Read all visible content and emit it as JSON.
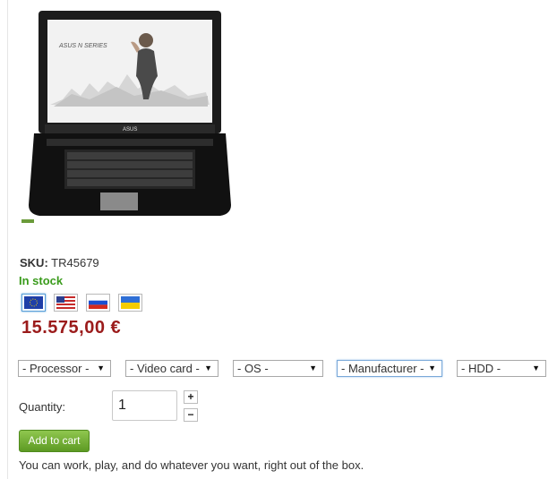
{
  "product": {
    "image_logo_text": "ASUS",
    "image_series_text": "ASUS N SERIES",
    "sku_label": "SKU:",
    "sku_value": "TR45679",
    "stock": "In stock",
    "price": "15.575,00 €",
    "description": "You can work, play, and do whatever you want, right out of the box."
  },
  "currency_flags": [
    {
      "name": "eu-flag-icon",
      "active": true
    },
    {
      "name": "us-flag-icon",
      "active": false
    },
    {
      "name": "ru-flag-icon",
      "active": false
    },
    {
      "name": "ua-flag-icon",
      "active": false
    }
  ],
  "filters": {
    "processor": "- Processor -",
    "video_card": "- Video card -",
    "os": "- OS -",
    "manufacturer": "- Manufacturer -",
    "hdd": "- HDD -"
  },
  "quantity": {
    "label": "Quantity:",
    "value": "1",
    "plus": "+",
    "minus": "−"
  },
  "cart": {
    "button_label": "Add to cart"
  },
  "colors": {
    "price": "#9b1b1b",
    "in_stock": "#3a9b1c",
    "button": "#6aa52e"
  }
}
